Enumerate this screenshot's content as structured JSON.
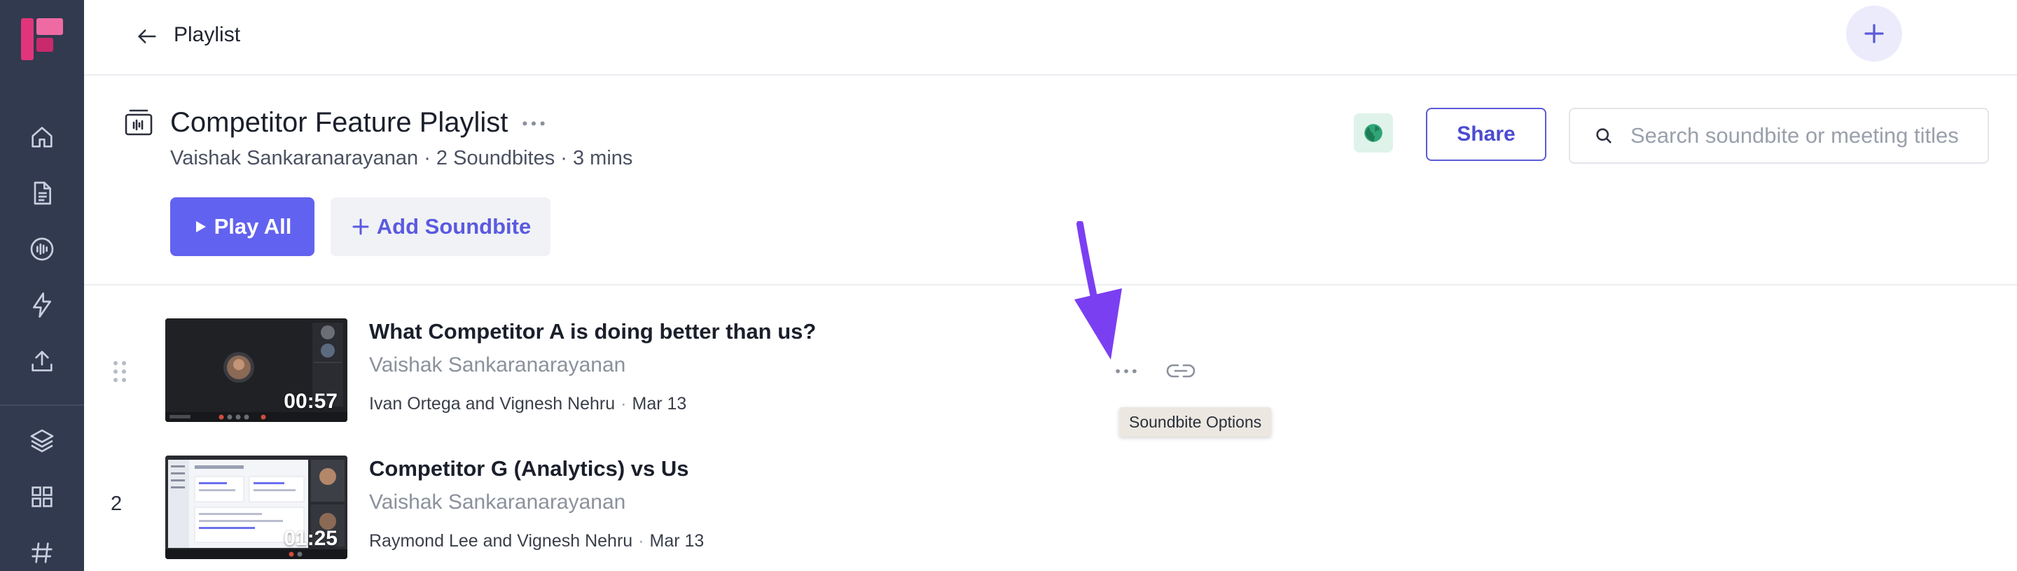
{
  "header": {
    "breadcrumb": "Playlist"
  },
  "playlist": {
    "title": "Competitor Feature Playlist",
    "meta": "Vaishak Sankaranarayanan · 2 Soundbites · 3 mins",
    "share_label": "Share",
    "search_placeholder": "Search soundbite or meeting titles",
    "play_all_label": "Play All",
    "add_soundbite_label": "Add Soundbite"
  },
  "soundbites": [
    {
      "title": "What Competitor A is doing better than us?",
      "owner": "Vaishak Sankaranarayanan",
      "participants": "Ivan Ortega and Vignesh Nehru",
      "date": "Mar 13",
      "duration": "00:57"
    },
    {
      "number": "2",
      "title": "Competitor G (Analytics) vs Us",
      "owner": "Vaishak Sankaranarayanan",
      "participants": "Raymond Lee and Vignesh Nehru",
      "date": "Mar 13",
      "duration": "01:25"
    }
  ],
  "tooltip": "Soundbite Options",
  "sidebar": {
    "icons": [
      "home-icon",
      "document-icon",
      "soundwave-icon",
      "lightning-icon",
      "upload-icon",
      "layers-icon",
      "apps-grid-icon",
      "hashtag-icon"
    ]
  },
  "colors": {
    "sidebar_bg": "#313a4f",
    "accent": "#6262f0",
    "annotation_arrow": "#7b3ff2",
    "logo_primary": "#e0357a"
  }
}
